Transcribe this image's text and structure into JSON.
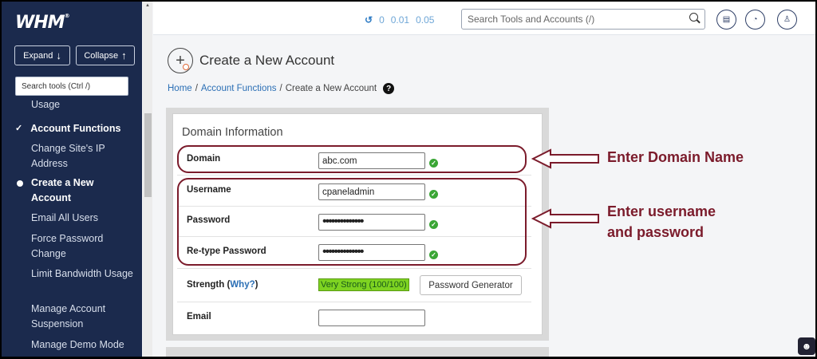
{
  "sidebar": {
    "logo": "WHM",
    "logo_mark": "®",
    "expand_label": "Expand",
    "collapse_label": "Collapse",
    "search_placeholder": "Search tools (Ctrl /)",
    "items": [
      {
        "label": "Usage"
      },
      {
        "label": "Account Functions"
      },
      {
        "label": "Change Site's IP Address"
      },
      {
        "label": "Create a New Account"
      },
      {
        "label": "Email All Users"
      },
      {
        "label": "Force Password Change"
      },
      {
        "label": "Limit Bandwidth Usage"
      },
      {
        "label": "Manage Account Suspension"
      },
      {
        "label": "Manage Demo Mode"
      }
    ]
  },
  "header": {
    "load": [
      "0",
      "0.01",
      "0.05"
    ],
    "search_placeholder": "Search Tools and Accounts (/)"
  },
  "page": {
    "title": "Create a New Account",
    "breadcrumb": [
      {
        "label": "Home"
      },
      {
        "label": "Account Functions"
      },
      {
        "label": "Create a New Account"
      }
    ]
  },
  "form": {
    "section_title": "Domain Information",
    "domain_label": "Domain",
    "domain_value": "abc.com",
    "username_label": "Username",
    "username_value": "cpaneladmin",
    "password_label": "Password",
    "password_value": "••••••••••••••",
    "retype_label": "Re-type Password",
    "retype_value": "••••••••••••••",
    "strength_label": "Strength (",
    "strength_why": "Why?",
    "strength_close": ")",
    "strength_value": "Very Strong (100/100)",
    "generator_label": "Password Generator",
    "email_label": "Email",
    "email_value": ""
  },
  "annotations": {
    "domain_note": "Enter Domain Name",
    "credentials_note_line1": "Enter username",
    "credentials_note_line2": "and password",
    "color": "#7b1b2b"
  }
}
